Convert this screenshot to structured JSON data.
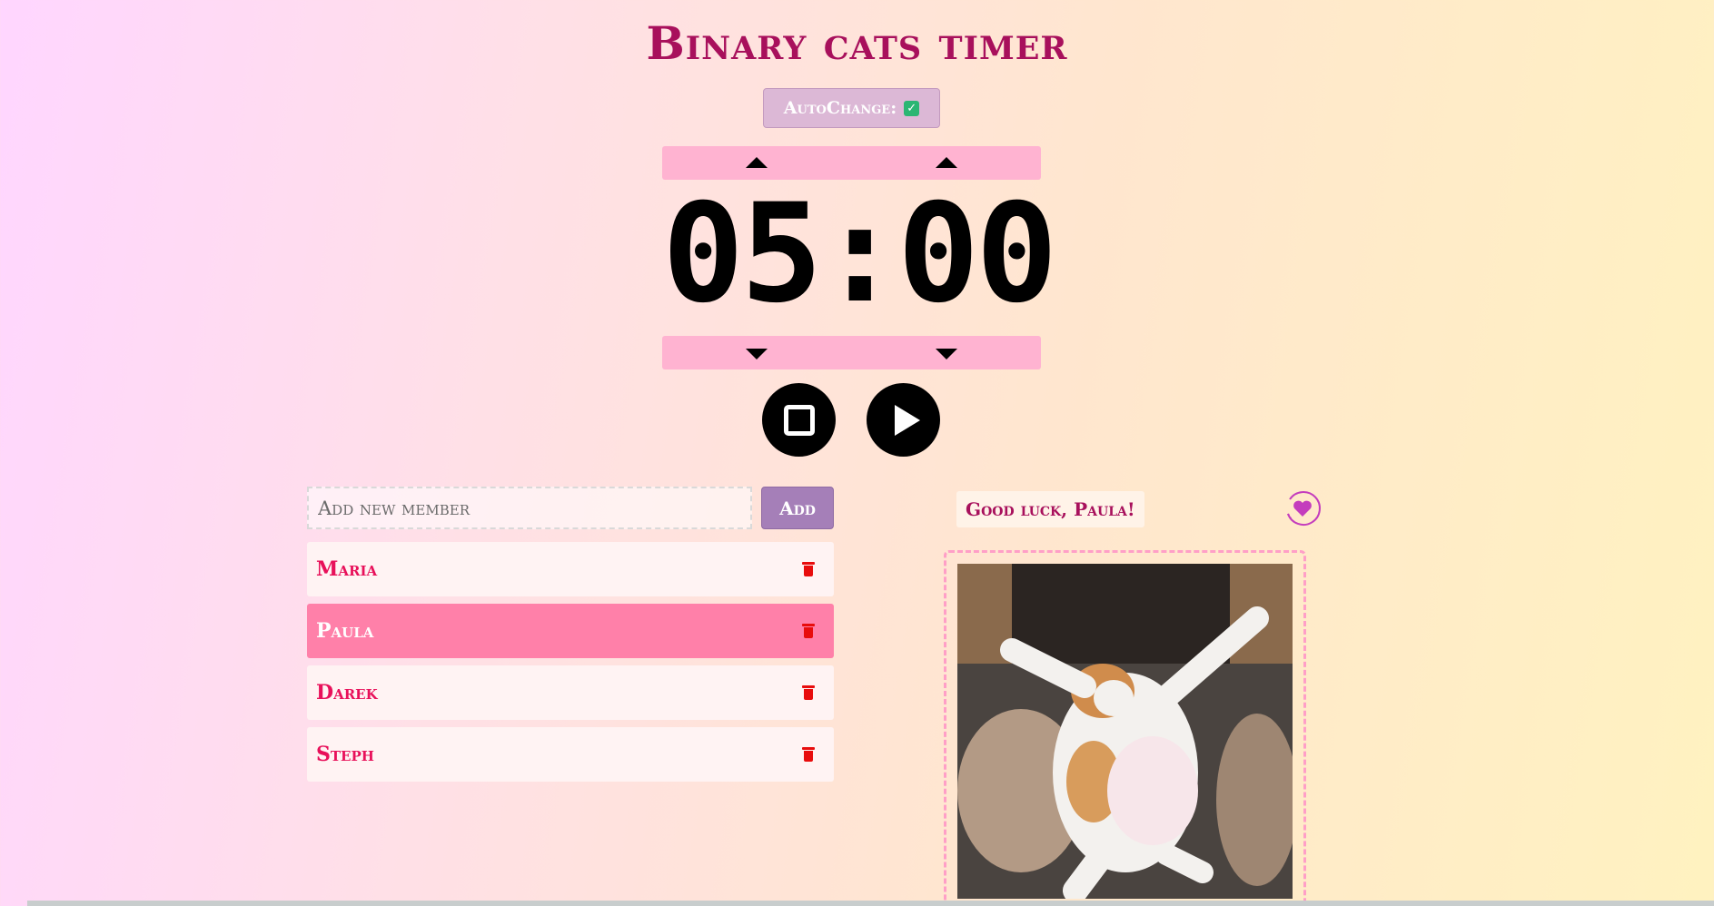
{
  "title": "Binary cats timer",
  "autochange": {
    "label": "AutoChange:",
    "checked": true
  },
  "timer": {
    "minutes": "05",
    "seconds": "00",
    "display": "05:00"
  },
  "controls": {
    "stop_icon": "stop-icon",
    "play_icon": "play-icon"
  },
  "members": {
    "input_placeholder": "Add new member",
    "add_label": "Add",
    "list": [
      {
        "name": "Maria",
        "active": false
      },
      {
        "name": "Paula",
        "active": true
      },
      {
        "name": "Darek",
        "active": false
      },
      {
        "name": "Steph",
        "active": false
      }
    ]
  },
  "greeting": "Good luck, Paula!",
  "colors": {
    "title": "#a8105c",
    "active_row": "#ff80a9",
    "member_text": "#e8105a",
    "delete_icon": "#e80c0c",
    "arrow_bar": "#ffb3d1"
  }
}
